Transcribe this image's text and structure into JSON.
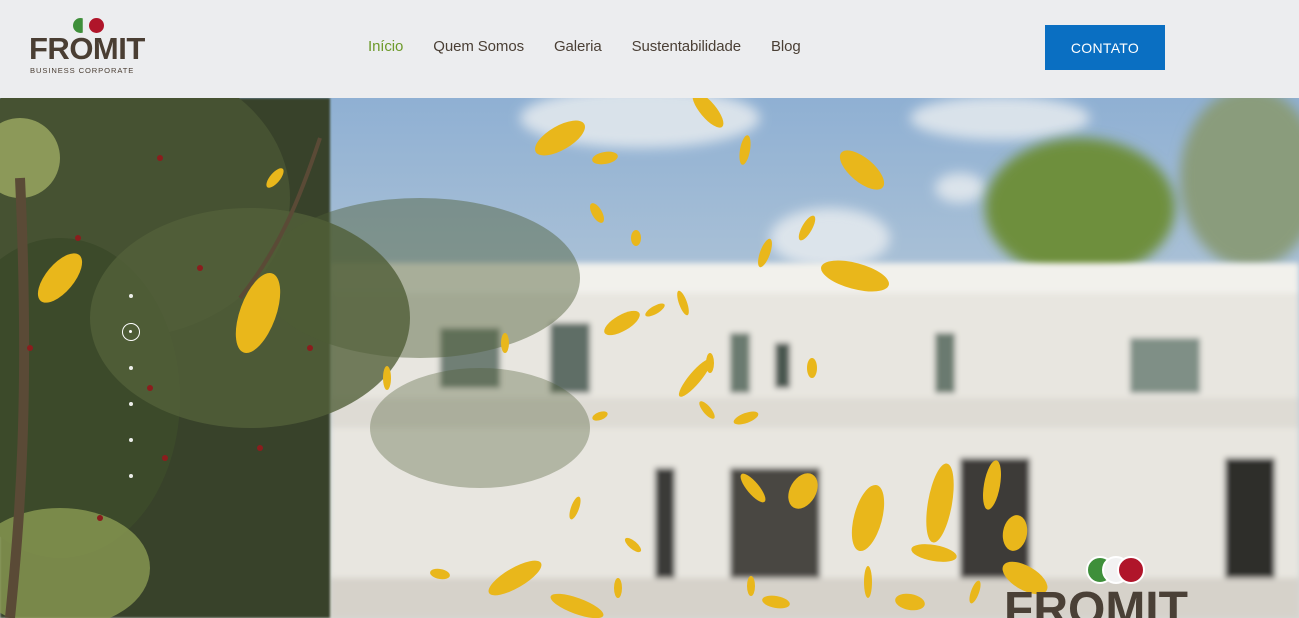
{
  "brand": {
    "name": "FROMIT",
    "tagline": "BUSINESS CORPORATE",
    "colors": {
      "green": "#3e8f3a",
      "red": "#b0152a",
      "text": "#4a3e33"
    }
  },
  "nav": {
    "items": [
      {
        "label": "Início",
        "active": true
      },
      {
        "label": "Quem Somos",
        "active": false
      },
      {
        "label": "Galeria",
        "active": false
      },
      {
        "label": "Sustentabilidade",
        "active": false
      },
      {
        "label": "Blog",
        "active": false
      }
    ],
    "active_color": "#6d9a2a"
  },
  "cta": {
    "label": "CONTATO",
    "color": "#0a6fc2"
  },
  "hero": {
    "slider": {
      "count": 6,
      "active_index": 1
    },
    "watermark_logo": "FROMIT"
  }
}
